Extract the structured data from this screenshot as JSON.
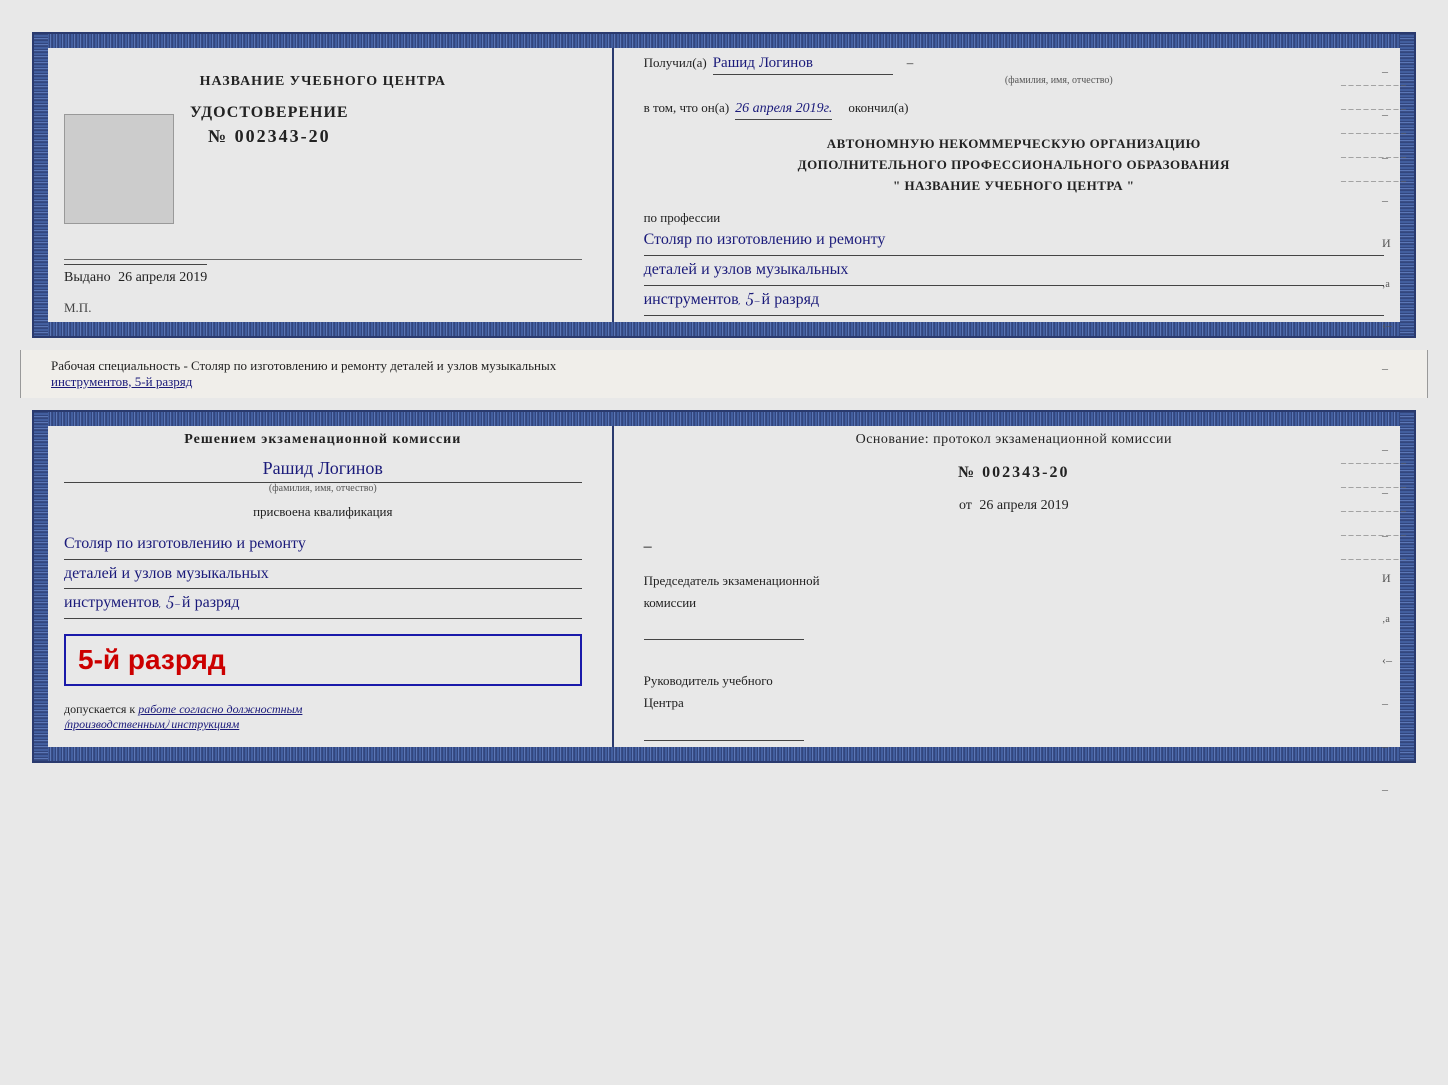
{
  "page": {
    "bg_color": "#e0ddd8"
  },
  "top_cert": {
    "left": {
      "institution_label": "НАЗВАНИЕ УЧЕБНОГО ЦЕНТРА",
      "cert_title": "УДОСТОВЕРЕНИЕ",
      "cert_prefix": "№",
      "cert_number": "002343-20",
      "vydano_label": "Выдано",
      "vydano_date": "26 апреля 2019",
      "mp_label": "М.П."
    },
    "right": {
      "poluchil_label": "Получил(а)",
      "poluchil_value": "Рашид Логинов",
      "poluchil_hint": "(фамилия, имя, отчество)",
      "dash": "–",
      "vtom_label": "в том, что он(а)",
      "vtom_date": "26 апреля 2019г.",
      "okonchill_label": "окончил(а)",
      "org_line1": "АВТОНОМНУЮ НЕКОММЕРЧЕСКУЮ ОРГАНИЗАЦИЮ",
      "org_line2": "ДОПОЛНИТЕЛЬНОГО ПРОФЕССИОНАЛЬНОГО ОБРАЗОВАНИЯ",
      "org_name": "\" НАЗВАНИЕ УЧЕБНОГО ЦЕНТРА \"",
      "profession_label": "по профессии",
      "profession_line1": "Столяр по изготовлению и ремонту",
      "profession_line2": "деталей и узлов музыкальных",
      "profession_line3": "инструментов, 5-й разряд"
    }
  },
  "middle": {
    "text1": "Рабочая специальность - Столяр по изготовлению и ремонту деталей и узлов музыкальных",
    "text2": "инструментов, 5-й разряд"
  },
  "bottom_cert": {
    "left": {
      "reshenie_label": "Решением экзаменационной комиссии",
      "name_value": "Рашид Логинов",
      "name_hint": "(фамилия, имя, отчество)",
      "prisvoena_label": "присвоена квалификация",
      "qual_line1": "Столяр по изготовлению и ремонту",
      "qual_line2": "деталей и узлов музыкальных",
      "qual_line3": "инструментов, 5-й разряд",
      "razryad_big": "5-й разряд",
      "dopuskaetsya_label": "допускается к",
      "dopuskaetsya_value": "работе согласно должностным",
      "dopuskaetsya_value2": "(производственным) инструкциям"
    },
    "right": {
      "osnovanie_label": "Основание: протокол экзаменационной комиссии",
      "protocol_prefix": "№",
      "protocol_number": "002343-20",
      "ot_label": "от",
      "ot_date": "26 апреля 2019",
      "predsedatel_label1": "Председатель экзаменационной",
      "predsedatel_label2": "комиссии",
      "rukovoditel_label1": "Руководитель учебного",
      "rukovoditel_label2": "Центра"
    }
  }
}
